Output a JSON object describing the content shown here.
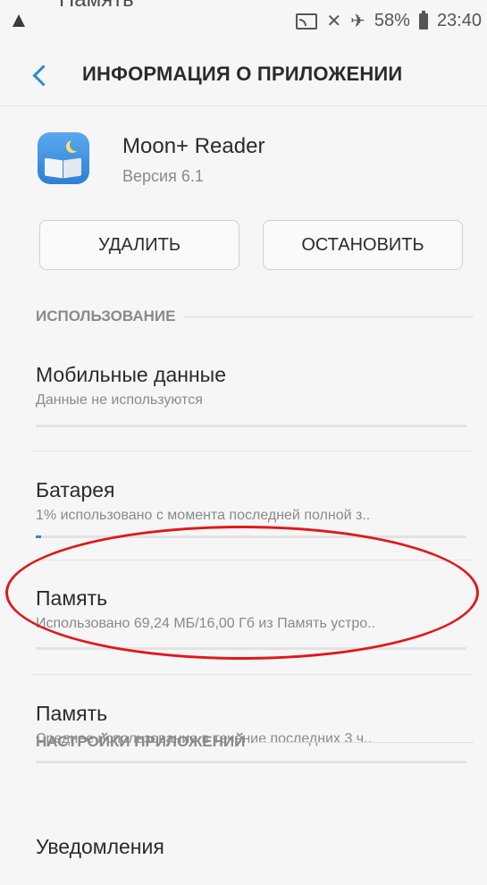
{
  "ghost_text": "Память",
  "status_bar": {
    "battery_percent": "58%",
    "time": "23:40"
  },
  "header": {
    "title": "ИНФОРМАЦИЯ О ПРИЛОЖЕНИИ"
  },
  "app": {
    "name": "Moon+ Reader",
    "version": "Версия 6.1"
  },
  "actions": {
    "delete_label": "УДАЛИТЬ",
    "stop_label": "ОСТАНОВИТЬ"
  },
  "sections": {
    "usage": "ИСПОЛЬЗОВАНИЕ",
    "app_settings": "НАСТРОЙКИ ПРИЛОЖЕНИЙ"
  },
  "usage_items": [
    {
      "title": "Мобильные данные",
      "subtitle": "Данные не используются",
      "progress": 0
    },
    {
      "title": "Батарея",
      "subtitle": "1% использовано с момента последней полной з..",
      "progress": 0.01
    },
    {
      "title": "Память",
      "subtitle": "Использовано 69,24 МБ/16,00 Гб из Память устро..",
      "progress": 0
    },
    {
      "title": "Память",
      "subtitle": "Среднее использование в течение последних 3 ч..",
      "progress": 0
    }
  ],
  "settings_items": [
    {
      "title": "Уведомления"
    }
  ],
  "colors": {
    "accent": "#2d8ad0",
    "highlight": "#e01818",
    "background": "#f6f6f6"
  }
}
